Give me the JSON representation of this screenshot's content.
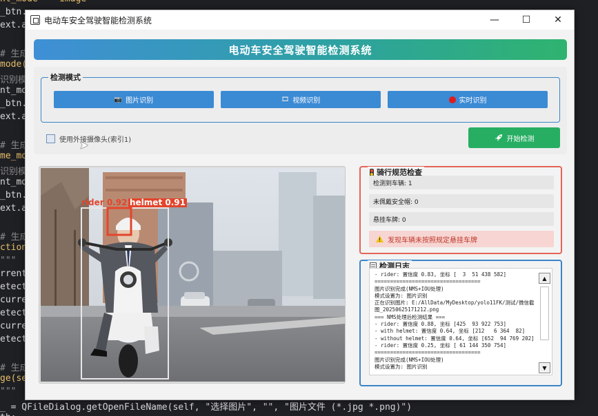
{
  "background_code": [
    {
      "text": "nt_mode = 'image'",
      "cls": "yellow"
    },
    {
      "text": "_btn.",
      "cls": ""
    },
    {
      "text": "ext.a",
      "cls": ""
    },
    {
      "text": "",
      "cls": ""
    },
    {
      "text": "# 生成S",
      "cls": "gray"
    },
    {
      "text": "mode(",
      "cls": "yellow"
    },
    {
      "text": "识别模",
      "cls": "gray"
    },
    {
      "text": "nt_mo",
      "cls": ""
    },
    {
      "text": "_btn.",
      "cls": ""
    },
    {
      "text": "ext.a",
      "cls": ""
    },
    {
      "text": "",
      "cls": ""
    },
    {
      "text": "# 生成S",
      "cls": "gray"
    },
    {
      "text": "me_mo",
      "cls": "yellow"
    },
    {
      "text": "识别模",
      "cls": "gray"
    },
    {
      "text": "nt_mo",
      "cls": ""
    },
    {
      "text": "_btn.",
      "cls": ""
    },
    {
      "text": "ext.a",
      "cls": ""
    },
    {
      "text": "",
      "cls": ""
    },
    {
      "text": "# 生成S",
      "cls": "gray"
    },
    {
      "text": "ction",
      "cls": "yellow"
    },
    {
      "text": "\"\"\"",
      "cls": "gray"
    },
    {
      "text": "rrent",
      "cls": ""
    },
    {
      "text": "etect",
      "cls": ""
    },
    {
      "text": "curre",
      "cls": ""
    },
    {
      "text": "etect",
      "cls": ""
    },
    {
      "text": "curre",
      "cls": ""
    },
    {
      "text": "etect",
      "cls": ""
    },
    {
      "text": "",
      "cls": ""
    },
    {
      "text": "# 生成S",
      "cls": "gray"
    },
    {
      "text": "ge(se",
      "cls": "yellow"
    },
    {
      "text": "\"\"\"",
      "cls": "gray"
    },
    {
      "text": "_ = QFileDialog.getOpenFileName(self, \"选择图片\", \"\", \"图片文件 (*.jpg *.png)\")",
      "cls": ""
    },
    {
      "text": "th:",
      "cls": ""
    }
  ],
  "window": {
    "title": "电动车安全驾驶智能检测系统",
    "minimize": "—",
    "maximize": "☐",
    "close": "✕"
  },
  "header": {
    "title": "电动车安全驾驶智能检测系统"
  },
  "mode": {
    "legend": "检测模式",
    "image_btn": "图片识别",
    "video_btn": "视频识别",
    "realtime_btn": "实时识别",
    "image_icon": "📷",
    "video_icon": "🎞"
  },
  "camera_checkbox": {
    "label": "使用外接摄像头(索引1)",
    "checked": false
  },
  "start_btn": {
    "label": "开始检测",
    "icon": "rocket-icon"
  },
  "detections": [
    {
      "label": "rider 0.92",
      "color": "#e2452c"
    },
    {
      "label": "helmet 0.91",
      "color": "#e2452c"
    }
  ],
  "rules": {
    "title": "骑行规范检查",
    "vehicles_detected": "检测到车辆: 1",
    "no_helmet": "未佩戴安全帽: 0",
    "plate_hanging": "悬挂车牌: 0",
    "alert": "发现车辆未按照规定悬挂车牌",
    "accent": "#e46457"
  },
  "log": {
    "title": "检测日志",
    "lines": [
      "- rider: 置信度 0.83, 坐标 [  3  51 438 582]",
      "==================================",
      "图片识别完成(NMS+IOU处理)",
      "模式设置为: 图片识别",
      "正在识别图片: E:/AllData/MyDesktop/yolo11FK/测试/微信截图_20250625171212.png",
      "=== NMS处理后检测结果 ===",
      "- rider: 置信度 0.88, 坐标 [425  93 922 753]",
      "- with helmet: 置信度 0.64, 坐标 [212   6 364  82]",
      "- without helmet: 置信度 0.64, 坐标 [652  94 769 202]",
      "- rider: 置信度 0.25, 坐标 [ 61 144 350 754]",
      "==================================",
      "图片识别完成(NMS+IOU处理)",
      "模式设置为: 图片识别"
    ]
  }
}
